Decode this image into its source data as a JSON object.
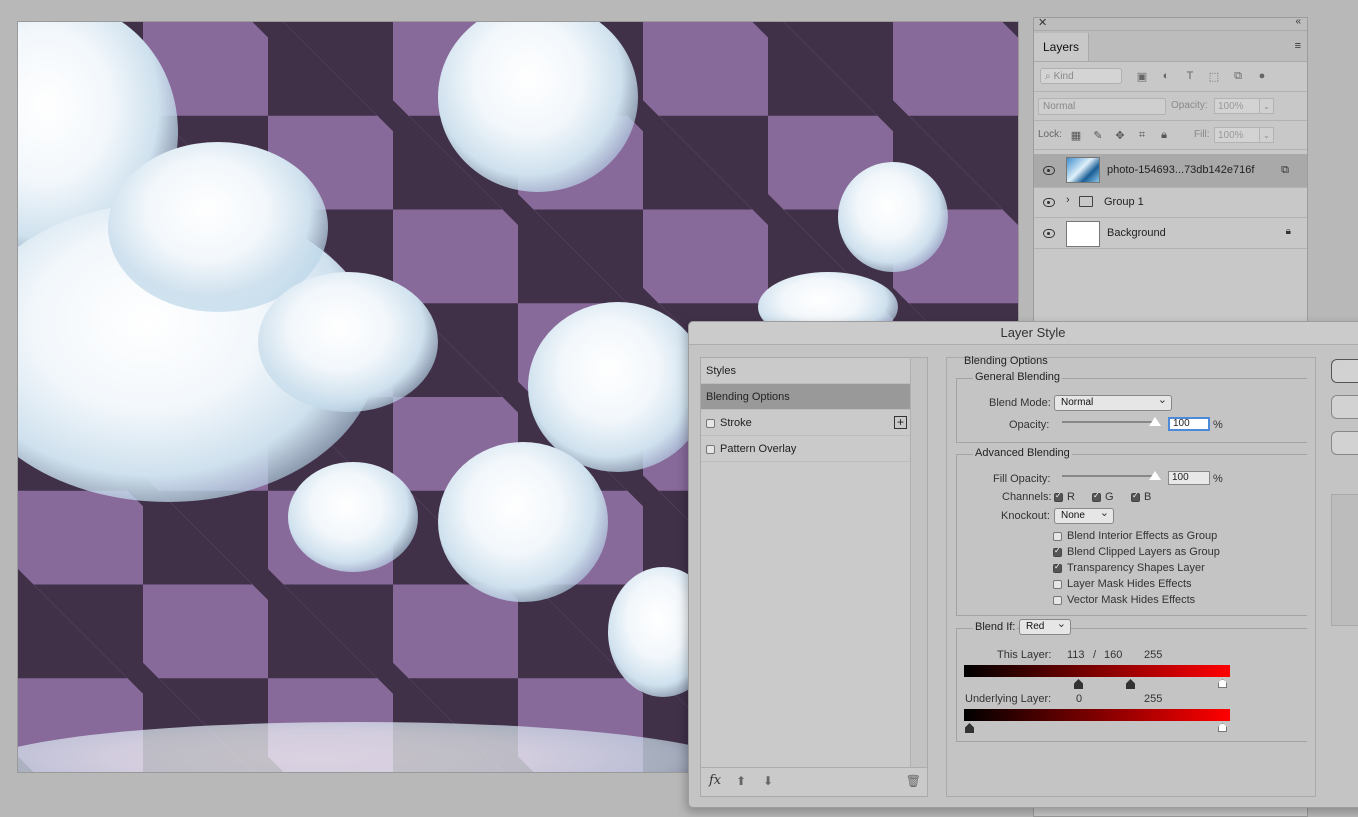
{
  "layers_panel": {
    "tab_label": "Layers",
    "kind_placeholder": "Kind",
    "blend_mode": "Normal",
    "opacity_label": "Opacity:",
    "opacity_value": "100%",
    "lock_label": "Lock:",
    "fill_label": "Fill:",
    "fill_value": "100%",
    "layers": [
      {
        "name": "photo-154693...73db142e716f",
        "selected": true
      },
      {
        "name": "Group 1"
      },
      {
        "name": "Background"
      }
    ]
  },
  "dialog": {
    "title": "Layer Style",
    "styles_list": {
      "items": [
        {
          "label": "Styles"
        },
        {
          "label": "Blending Options",
          "selected": true
        },
        {
          "label": "Stroke",
          "checked": false
        },
        {
          "label": "Pattern Overlay",
          "checked": false
        }
      ],
      "footer_fx": "fx"
    },
    "blending": {
      "section_title": "Blending Options",
      "general": {
        "title": "General Blending",
        "blend_mode_label": "Blend Mode:",
        "blend_mode": "Normal",
        "opacity_label": "Opacity:",
        "opacity_value": "100",
        "opacity_unit": "%"
      },
      "advanced": {
        "title": "Advanced Blending",
        "fill_opacity_label": "Fill Opacity:",
        "fill_opacity_value": "100",
        "fill_unit": "%",
        "channels_label": "Channels:",
        "channels": [
          {
            "label": "R",
            "checked": true
          },
          {
            "label": "G",
            "checked": true
          },
          {
            "label": "B",
            "checked": true
          }
        ],
        "knockout_label": "Knockout:",
        "knockout": "None",
        "options": [
          {
            "label": "Blend Interior Effects as Group",
            "checked": false
          },
          {
            "label": "Blend Clipped Layers as Group",
            "checked": true
          },
          {
            "label": "Transparency Shapes Layer",
            "checked": true
          },
          {
            "label": "Layer Mask Hides Effects",
            "checked": false
          },
          {
            "label": "Vector Mask Hides Effects",
            "checked": false
          }
        ]
      },
      "blend_if": {
        "label": "Blend If:",
        "channel": "Red",
        "this_layer_label": "This Layer:",
        "this_layer_low": "113",
        "this_layer_sep": "/",
        "this_layer_mid": "160",
        "this_layer_high": "255",
        "underlying_label": "Underlying Layer:",
        "underlying_low": "0",
        "underlying_high": "255"
      }
    }
  },
  "colors": {
    "checker_light": "#87699a",
    "checker_dark": "#403149",
    "focus_blue": "#4a8ad8"
  }
}
